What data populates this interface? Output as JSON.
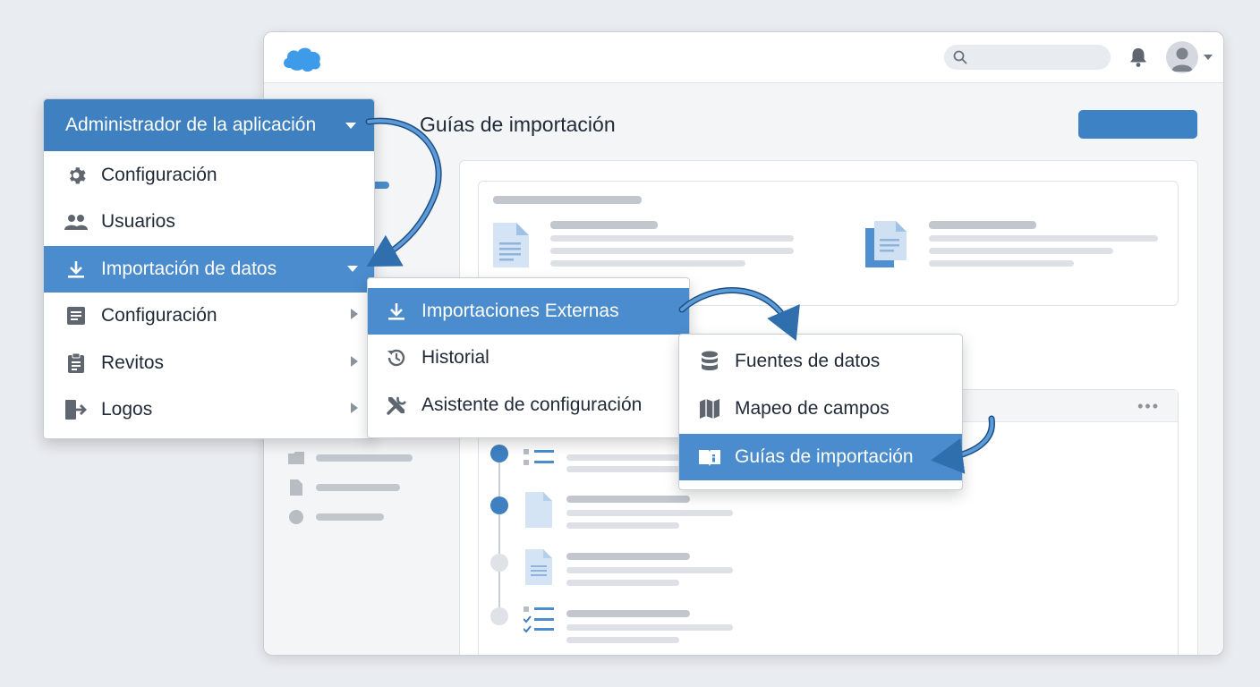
{
  "colors": {
    "accent": "#3e80c0",
    "active": "#4a8ccd",
    "brand_cloud": "#3d9be9"
  },
  "window": {
    "page_title": "Guías de importación",
    "icons": [
      "cloud-logo-icon",
      "search-icon",
      "bell-icon",
      "user-avatar-icon",
      "chevron-down-icon"
    ]
  },
  "admin_menu": {
    "header_label": "Administrador de la aplicación",
    "items": [
      {
        "label": "Configuración",
        "icon": "gear-icon",
        "submenu": false,
        "active": false
      },
      {
        "label": "Usuarios",
        "icon": "users-icon",
        "submenu": false,
        "active": false
      },
      {
        "label": "Importación de datos",
        "icon": "download-icon",
        "submenu": true,
        "active": true
      },
      {
        "label": "Configuración",
        "icon": "list-card-icon",
        "submenu": true,
        "active": false
      },
      {
        "label": "Revitos",
        "icon": "clipboard-icon",
        "submenu": true,
        "active": false
      },
      {
        "label": "Logos",
        "icon": "sign-out-icon",
        "submenu": true,
        "active": false
      }
    ]
  },
  "import_submenu": {
    "items": [
      {
        "label": "Importaciones Externas",
        "icon": "download-icon",
        "active": true
      },
      {
        "label": "Historial",
        "icon": "history-icon",
        "active": false
      },
      {
        "label": "Asistente de configuración",
        "icon": "tools-icon",
        "active": false
      }
    ]
  },
  "external_submenu": {
    "items": [
      {
        "label": "Fuentes de datos",
        "icon": "database-icon",
        "active": false
      },
      {
        "label": "Mapeo de campos",
        "icon": "map-icon",
        "active": false
      },
      {
        "label": "Guías de importación",
        "icon": "info-book-icon",
        "active": true
      }
    ]
  }
}
